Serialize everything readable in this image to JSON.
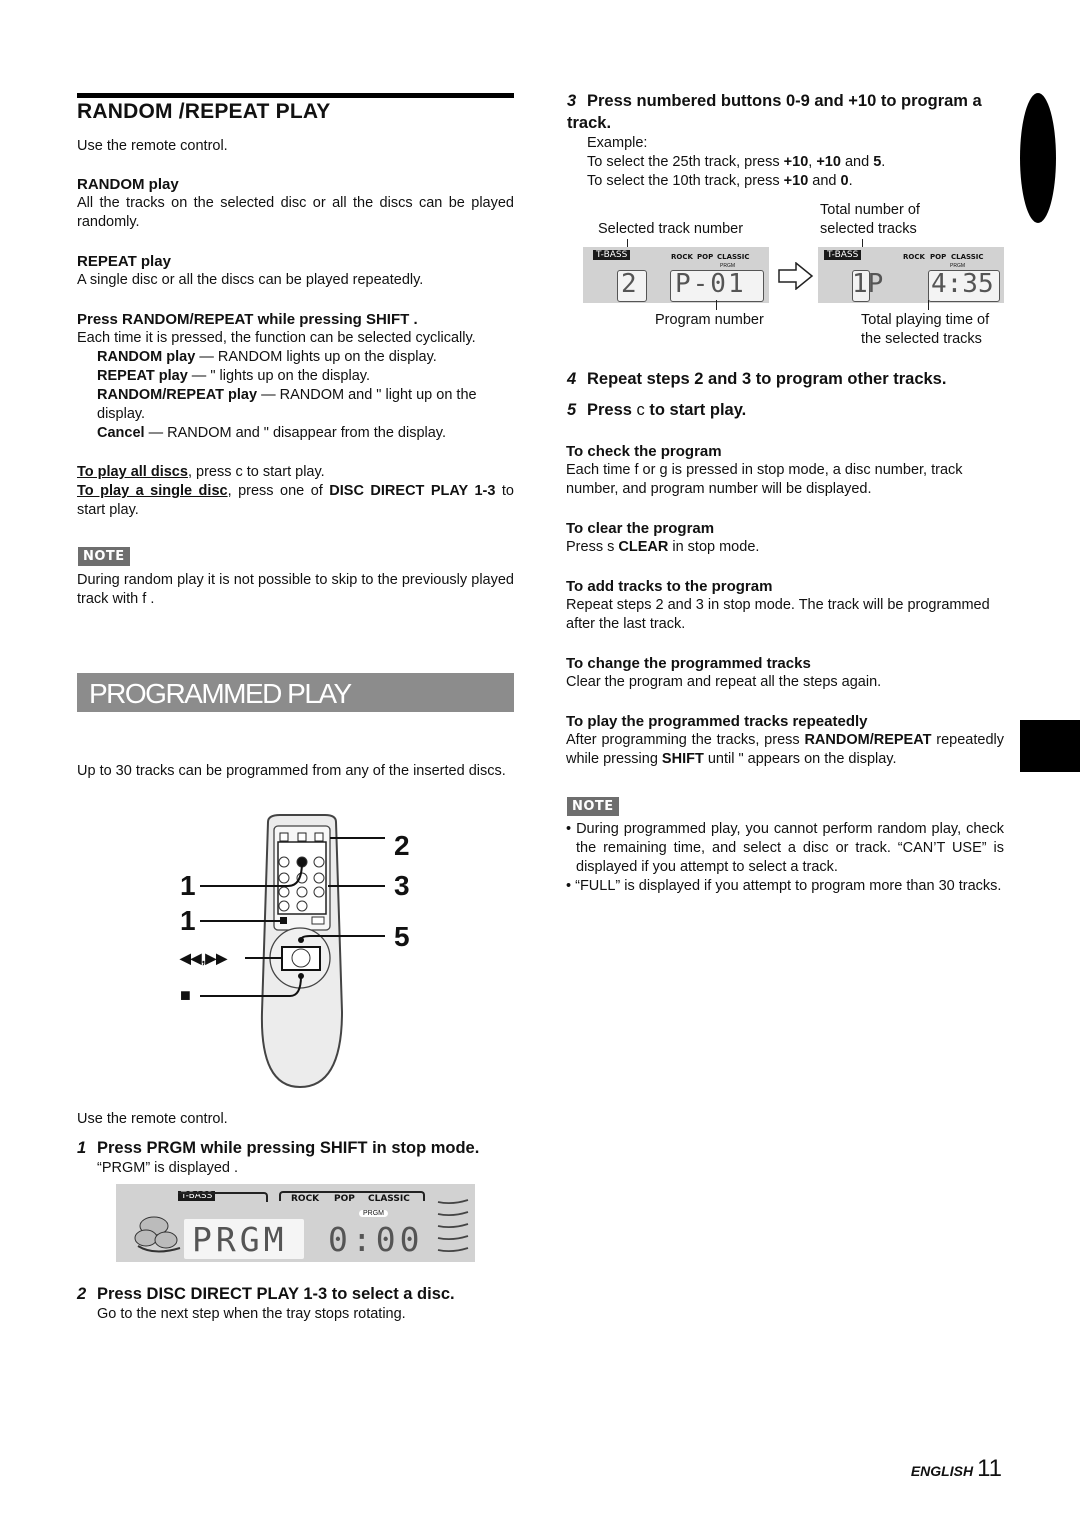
{
  "random_repeat": {
    "title": "RANDOM /REPEAT PLAY",
    "intro": "Use the remote control.",
    "random_play": {
      "heading": "RANDOM play",
      "text": "All the tracks on the selected disc or all the discs can be played randomly."
    },
    "repeat_play": {
      "heading": "REPEAT play",
      "text": "A single disc or all the discs can be played repeatedly."
    },
    "press_section": {
      "heading": "Press RANDOM/REPEAT while pressing SHIFT .",
      "text": "Each time it is pressed, the function can be selected cyclically.",
      "modes": [
        {
          "label": "RANDOM play",
          "desc": " — RANDOM lights up on the display."
        },
        {
          "label": "REPEAT play",
          "desc": " — \"    lights up on the display."
        },
        {
          "label": "RANDOM/REPEAT play",
          "desc": " — RANDOM and \"    light up on the display."
        },
        {
          "label": "Cancel",
          "desc": " — RANDOM and \"    disappear from the display."
        }
      ]
    },
    "play_all": {
      "label": "To play all discs",
      "text": ", press c    to start play."
    },
    "play_single": {
      "label": "To play a single disc",
      "text_a": ", press one of ",
      "bold": "DISC DIRECT PLAY 1-3",
      "text_b": " to start play."
    },
    "note": {
      "badge": "NOTE",
      "text": "During random play it is not possible to skip to the previously played track with f      ."
    }
  },
  "programmed": {
    "title": "PROGRAMMED PLAY",
    "intro": "Up to 30 tracks can be programmed from any of the inserted discs.",
    "remote_callouts": {
      "c1a": "1",
      "c1b": "1",
      "c2": "2",
      "c3": "3",
      "c5": "5",
      "skip": "◀◀,▶▶",
      "stop": "■"
    },
    "use_remote": "Use the remote control.",
    "steps": [
      {
        "num": "1",
        "heading": "Press PRGM while pressing SHIFT in stop mode.",
        "text": "“PRGM” is displayed ."
      },
      {
        "num": "2",
        "heading": "Press DISC DIRECT PLAY 1-3 to select a disc.",
        "text": "Go to the next step when the tray stops rotating."
      },
      {
        "num": "3",
        "heading": "Press numbered buttons 0-9 and +10 to program a track.",
        "example_label": "Example:",
        "example_1": {
          "a": "To select the 25th track, press ",
          "b1": "+10",
          "c": ", ",
          "b2": "+10",
          "d": " and ",
          "b3": "5",
          "e": "."
        },
        "example_2": {
          "a": "To select the 10th track, press ",
          "b1": "+10",
          "d": " and ",
          "b3": "0",
          "e": "."
        }
      },
      {
        "num": "4",
        "heading": "Repeat steps 2 and 3 to program other tracks."
      },
      {
        "num": "5",
        "heading_a": "Press ",
        "glyph": "c",
        "heading_b": " to start play."
      }
    ],
    "display1": {
      "tbass": "T-BASS",
      "eq": [
        "ROCK",
        "POP",
        "CLASSIC"
      ],
      "prgm": "PRGM",
      "main": "PRGM",
      "time": "0:00"
    },
    "display_example": {
      "label_selected_track": "Selected track number",
      "label_total_number": "Total number of selected tracks",
      "label_program_number": "Program number",
      "label_total_time": "Total playing time of the selected tracks",
      "before": {
        "track": "2",
        "program": "P-01"
      },
      "after": {
        "track": "1P",
        "time": "4:35"
      }
    },
    "tips": [
      {
        "heading": "To check the program",
        "text": "Each time f        or g      is pressed in stop mode, a disc number, track number, and program number will be displayed."
      },
      {
        "heading": "To clear the program",
        "text_a": "Press s   ",
        "bold": "CLEAR",
        "text_b": " in stop mode."
      },
      {
        "heading": "To add tracks to the program",
        "text": "Repeat steps 2 and 3 in stop mode. The track will be programmed after the last track."
      },
      {
        "heading": "To change the programmed tracks",
        "text": "Clear the program and repeat all the steps again."
      },
      {
        "heading": "To play the programmed tracks repeatedly",
        "text_a": "After programming the tracks, press ",
        "bold1": "RANDOM/REPEAT",
        "text_b": " repeatedly while pressing ",
        "bold2": "SHIFT",
        "text_c": " until \"    appears on the display."
      }
    ],
    "note": {
      "badge": "NOTE",
      "items": [
        "During programmed play, you cannot perform random play, check the remaining time, and select a disc or track. “CAN’T USE” is displayed if you attempt to select a track.",
        "“FULL” is displayed if you attempt to program more than 30 tracks."
      ]
    }
  },
  "footer": {
    "language": "ENGLISH",
    "page": "11"
  }
}
